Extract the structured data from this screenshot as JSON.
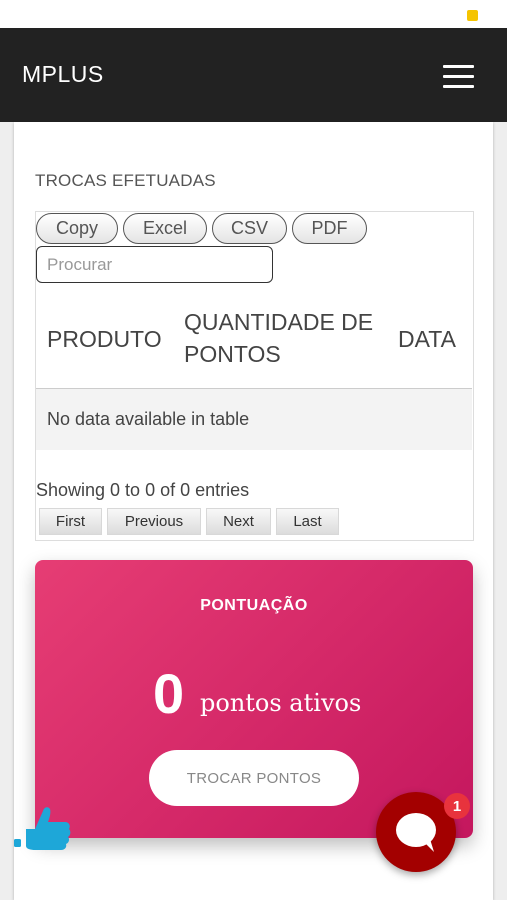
{
  "header": {
    "brand": "MPLUS",
    "menu_icon": "hamburger-menu-icon"
  },
  "section": {
    "title": "TROCAS EFETUADAS"
  },
  "table": {
    "export_buttons": [
      "Copy",
      "Excel",
      "CSV",
      "PDF"
    ],
    "search_placeholder": "Procurar",
    "columns": [
      "PRODUTO",
      "QUANTIDADE DE PONTOS",
      "DATA"
    ],
    "column_lines": {
      "quantity_line1": "QUANTIDADE DE",
      "quantity_line2": "PONTOS"
    },
    "empty_message": "No data available in table",
    "info": "Showing 0 to 0 of 0 entries",
    "pagination": [
      "First",
      "Previous",
      "Next",
      "Last"
    ]
  },
  "score": {
    "label": "PONTUAÇÃO",
    "value": "0",
    "unit": "pontos ativos",
    "button": "TROCAR PONTOS"
  },
  "widgets": {
    "like_icon": "thumbs-up-icon",
    "chat_icon": "chat-bubble-icon",
    "chat_badge": "1"
  },
  "colors": {
    "navbar": "#222222",
    "score_card_start": "#e63d74",
    "score_card_end": "#c4175e",
    "chat": "#a30000",
    "badge": "#e8333d",
    "like": "#1ea7d8"
  }
}
